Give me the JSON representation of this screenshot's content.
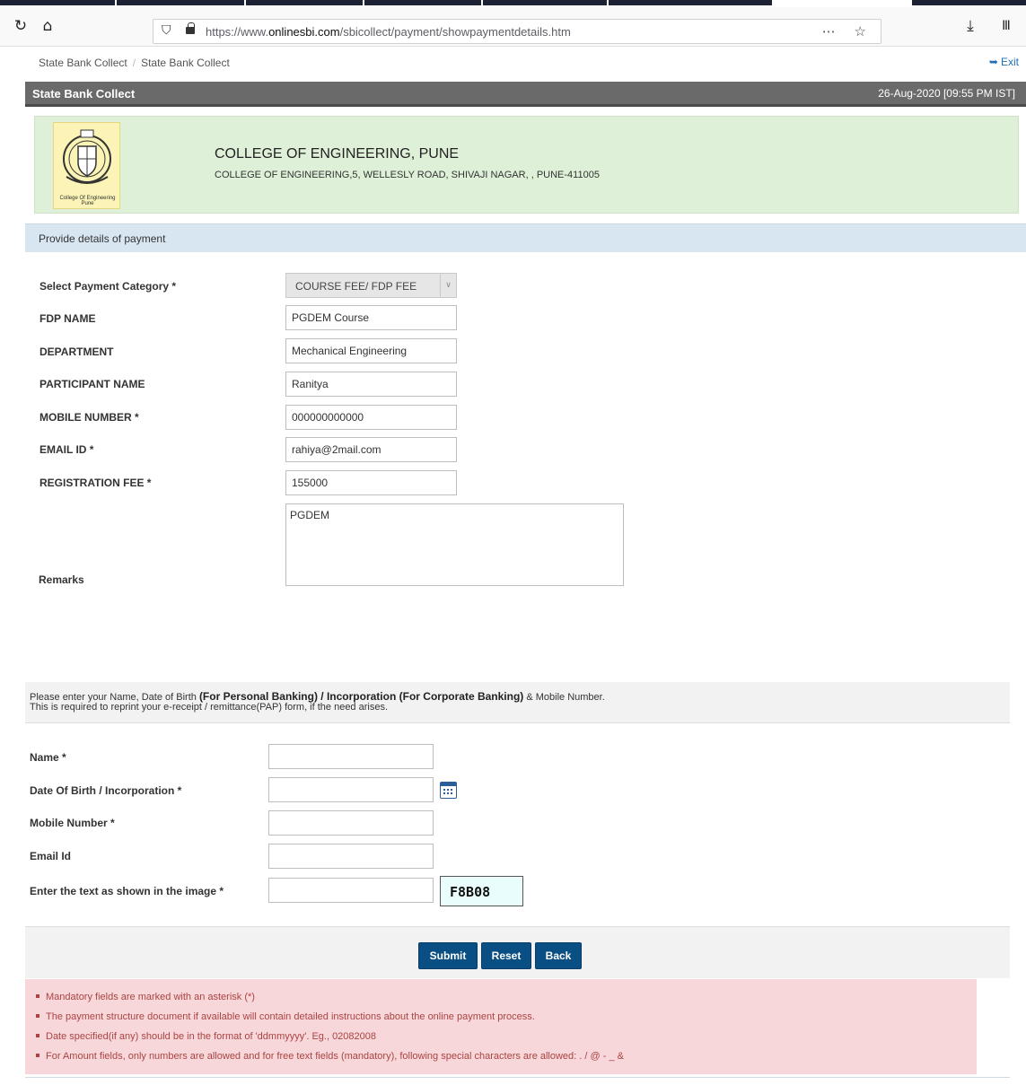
{
  "browser": {
    "url_prefix": "https://www.",
    "url_domain": "onlinesbi.com",
    "url_path": "/sbicollect/payment/showpaymentdetails.htm"
  },
  "breadcrumb": {
    "item1": "State Bank Collect",
    "item2": "State Bank Collect",
    "separator": "/"
  },
  "exit_label": "Exit",
  "titlebar": {
    "title": "State Bank Collect",
    "datetime": "26-Aug-2020 [09:55 PM IST]"
  },
  "college": {
    "name": "COLLEGE OF ENGINEERING, PUNE",
    "address": "COLLEGE OF ENGINEERING,5, WELLESLY ROAD, SHIVAJI NAGAR, , PUNE-411005",
    "logo_caption_line1": "College Of Engineering",
    "logo_caption_line2": "Pune"
  },
  "section_header": "Provide details of payment",
  "payment_form": {
    "category_label": "Select Payment Category *",
    "category_value": "COURSE FEE/ FDP FEE",
    "fdp_name_label": "FDP NAME",
    "fdp_name_value": "PGDEM Course",
    "department_label": "DEPARTMENT",
    "department_value": "Mechanical Engineering",
    "participant_label": "PARTICIPANT NAME",
    "participant_value": "Ranitya",
    "mobile_label": "MOBILE NUMBER *",
    "mobile_value": "000000000000",
    "email_label": "EMAIL ID *",
    "email_value": "rahiya@2mail.com",
    "fee_label": "REGISTRATION FEE *",
    "fee_value": "155000",
    "remarks_label": "Remarks",
    "remarks_value": "PGDEM"
  },
  "personal_info": {
    "line1_a": "Please enter your Name, Date of Birth ",
    "line1_b": "(For Personal Banking) / Incorporation (For Corporate Banking)",
    "line1_c": "  & Mobile Number.",
    "line2": "This is required to reprint your e-receipt / remittance(PAP) form, if the need arises.",
    "name_label": "Name *",
    "dob_label": "Date Of Birth / Incorporation *",
    "mobile_label": "Mobile Number *",
    "email_label": "Email Id",
    "captcha_label": "Enter the text as shown in the image *",
    "captcha_text": "F8B08"
  },
  "buttons": {
    "submit": "Submit",
    "reset": "Reset",
    "back": "Back"
  },
  "notes": [
    "Mandatory fields are marked with an asterisk (*)",
    "The payment structure document if available will contain detailed instructions about the online payment process.",
    "Date specified(if any) should be in the format of 'ddmmyyyy'. Eg., 02082008",
    "For Amount fields, only numbers are allowed and for free text fields (mandatory), following special characters are allowed: . / @ - _ &"
  ]
}
